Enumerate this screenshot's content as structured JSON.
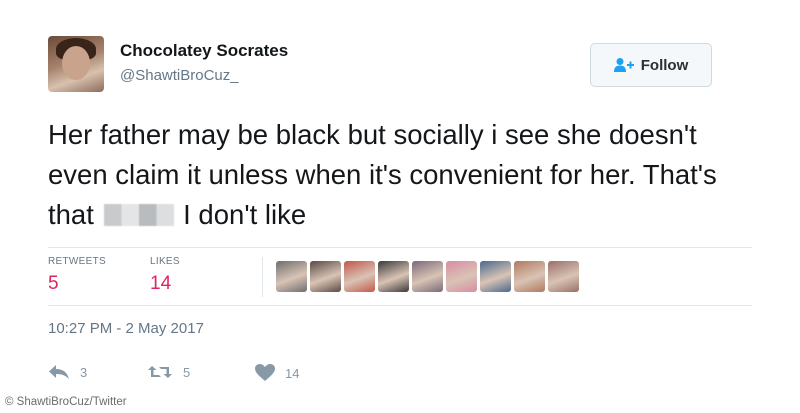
{
  "user": {
    "display_name": "Chocolatey Socrates",
    "handle": "@ShawtiBroCuz_"
  },
  "follow_button": {
    "label": "Follow",
    "icon": "add-user-icon"
  },
  "tweet": {
    "text_before": "Her father may be black but socially i see she doesn't even claim it unless when it's convenient for her. That's that",
    "text_after": "I don't like"
  },
  "stats": {
    "retweets_label": "RETWEETS",
    "retweets_value": "5",
    "likes_label": "LIKES",
    "likes_value": "14"
  },
  "likers": [
    {
      "color": "#6e6e6e"
    },
    {
      "color": "#5a4a44"
    },
    {
      "color": "#c2584a"
    },
    {
      "color": "#3a3a3a"
    },
    {
      "color": "#7a6a78"
    },
    {
      "color": "#d98ca3"
    },
    {
      "color": "#4a6a8c"
    },
    {
      "color": "#b07a5e"
    },
    {
      "color": "#9a6f6a"
    }
  ],
  "timestamp": "10:27 PM - 2 May 2017",
  "actions": {
    "reply_count": "3",
    "retweet_count": "5",
    "like_count": "14"
  },
  "credit": "© ShawtiBroCuz/Twitter",
  "colors": {
    "text": "#14171a",
    "secondary": "#657786",
    "likes_accent": "#e0245e",
    "follow_blue": "#1da1f2"
  }
}
